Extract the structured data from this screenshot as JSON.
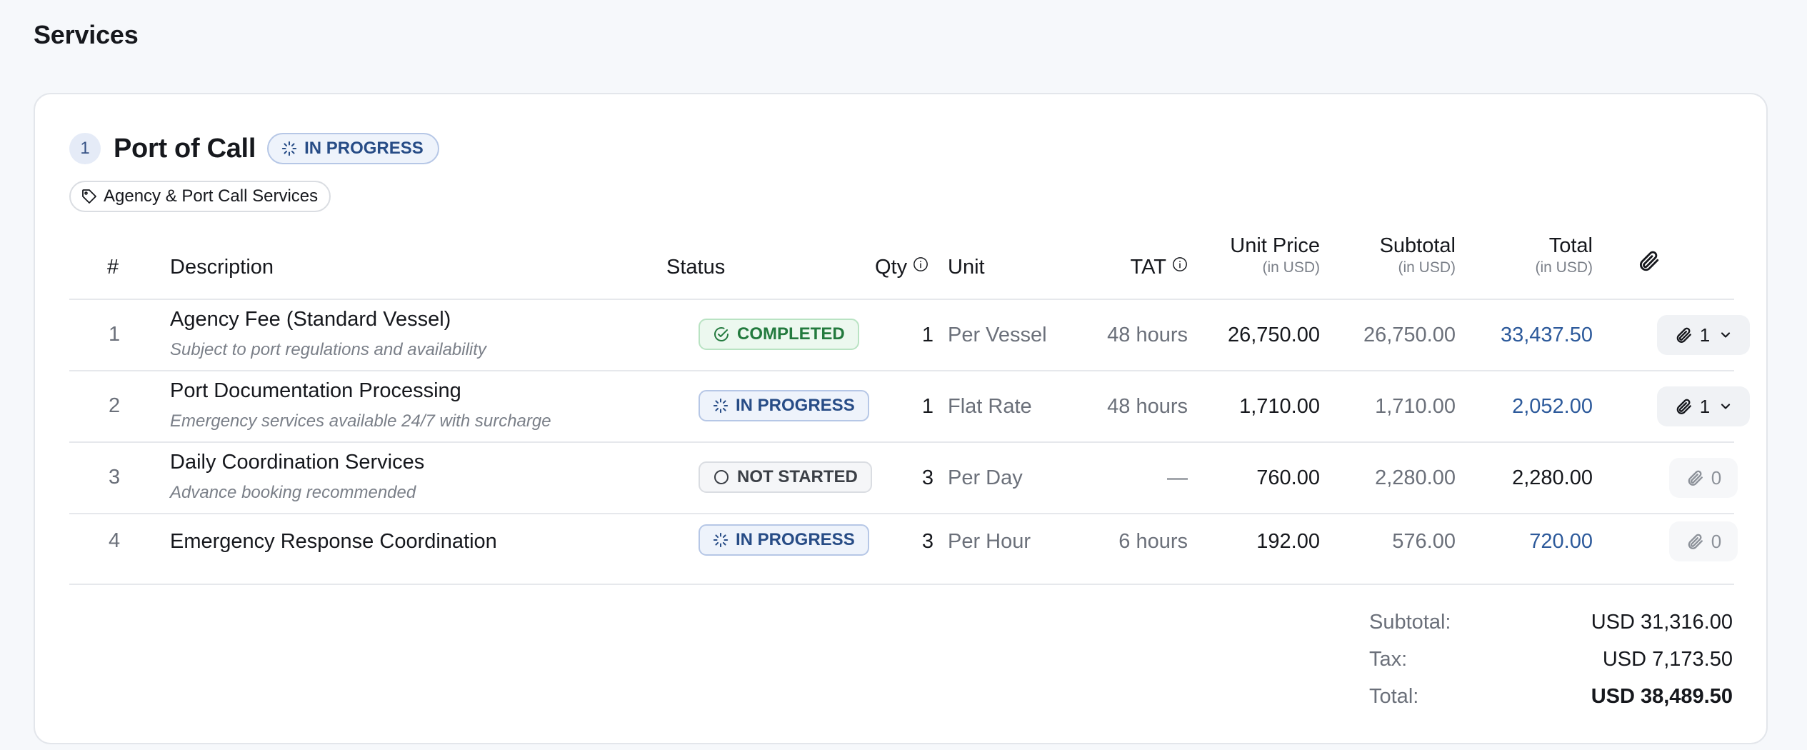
{
  "page": {
    "title": "Services"
  },
  "section": {
    "number": "1",
    "title": "Port of Call",
    "status": "IN PROGRESS",
    "tag": "Agency & Port Call Services"
  },
  "table": {
    "headers": {
      "num": "#",
      "description": "Description",
      "status": "Status",
      "qty": "Qty",
      "unit": "Unit",
      "tat": "TAT",
      "unit_price": "Unit Price",
      "unit_price_sub": "(in USD)",
      "subtotal": "Subtotal",
      "subtotal_sub": "(in USD)",
      "total": "Total",
      "total_sub": "(in USD)",
      "attachments_icon": "paperclip-icon"
    },
    "rows": [
      {
        "num": "1",
        "description": "Agency Fee (Standard Vessel)",
        "note": "Subject to port regulations and availability",
        "status": "COMPLETED",
        "qty": "1",
        "unit": "Per Vessel",
        "tat": "48 hours",
        "unit_price": "26,750.00",
        "subtotal": "26,750.00",
        "total": "33,437.50",
        "attachments": "1"
      },
      {
        "num": "2",
        "description": "Port Documentation Processing",
        "note": "Emergency services available 24/7 with surcharge",
        "status": "IN PROGRESS",
        "qty": "1",
        "unit": "Flat Rate",
        "tat": "48 hours",
        "unit_price": "1,710.00",
        "subtotal": "1,710.00",
        "total": "2,052.00",
        "attachments": "1"
      },
      {
        "num": "3",
        "description": "Daily Coordination Services",
        "note": "Advance booking recommended",
        "status": "NOT STARTED",
        "qty": "3",
        "unit": "Per Day",
        "tat": "—",
        "unit_price": "760.00",
        "subtotal": "2,280.00",
        "total": "2,280.00",
        "attachments": "0"
      },
      {
        "num": "4",
        "description": "Emergency Response Coordination",
        "note": "",
        "status": "IN PROGRESS",
        "qty": "3",
        "unit": "Per Hour",
        "tat": "6 hours",
        "unit_price": "192.00",
        "subtotal": "576.00",
        "total": "720.00",
        "attachments": "0"
      }
    ]
  },
  "summary": {
    "subtotal_label": "Subtotal:",
    "subtotal_value": "USD 31,316.00",
    "tax_label": "Tax:",
    "tax_value": "USD 7,173.50",
    "total_label": "Total:",
    "total_value": "USD 38,489.50"
  },
  "colors": {
    "completed": "#237a3e",
    "in_progress": "#274c86",
    "not_started": "#3b3f46",
    "total_link": "#2d5a9b"
  }
}
